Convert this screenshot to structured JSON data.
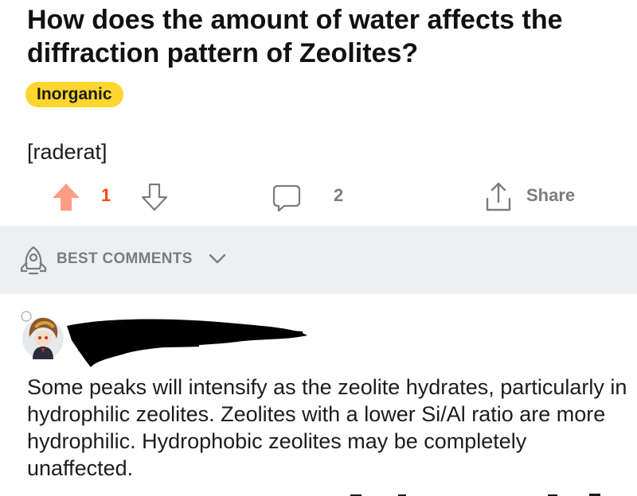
{
  "post": {
    "title": "How does the amount of water affects the diffraction pattern of Zeolites?",
    "flair": "Inorganic",
    "body": "[raderat]"
  },
  "actions": {
    "vote_count": "1",
    "comment_count": "2",
    "share_label": "Share"
  },
  "sort": {
    "label": "BEST COMMENTS"
  },
  "comment": {
    "text": "Some peaks will intensify as the zeolite hydrates, particularly in hydrophilic zeolites. Zeolites with a lower Si/Al ratio are more hydrophilic. Hydrophobic zeolites may be completely unaffected."
  },
  "colors": {
    "upvote_active": "#fc9e84",
    "vote_count": "#ff4500",
    "flair_background": "#ffd52e",
    "muted_text": "#7a7c7e",
    "sort_bar_background": "#eeeff1"
  },
  "icons": {
    "upvote": "upvote-arrow-icon",
    "downvote": "downvote-arrow-icon",
    "comment": "comment-bubble-icon",
    "share": "share-icon",
    "sort": "rocket-icon",
    "chevron": "chevron-down-icon"
  }
}
